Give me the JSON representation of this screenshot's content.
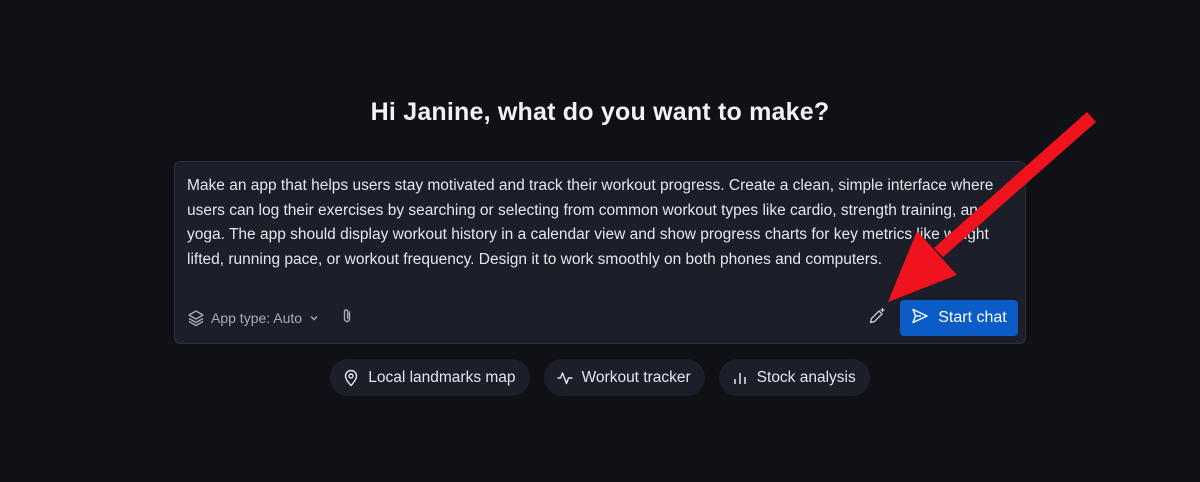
{
  "headline": "Hi Janine, what do you want to make?",
  "prompt": {
    "text": "Make an app that helps users stay motivated and track their workout progress. Create a clean, simple interface where users can log their exercises by searching or selecting from common workout types like cardio, strength training, and yoga. The app should display workout history in a calendar view and show progress charts for key metrics like weight lifted, running pace, or workout frequency. Design it to work smoothly on both phones and computers."
  },
  "footer": {
    "app_type_label": "App type: Auto",
    "app_type_icon": "layers-icon",
    "attach_icon": "paperclip-icon",
    "improve_icon": "pen-sparkle-icon",
    "start_label": "Start chat",
    "start_icon": "send-icon"
  },
  "suggestions": [
    {
      "label": "Local landmarks map",
      "icon": "map-pin-icon"
    },
    {
      "label": "Workout tracker",
      "icon": "activity-icon"
    },
    {
      "label": "Stock analysis",
      "icon": "bar-chart-icon"
    }
  ],
  "colors": {
    "background": "#0f1117",
    "card": "#1c1f29",
    "accent": "#0b5cc7",
    "annotation_arrow": "#f0131e"
  }
}
